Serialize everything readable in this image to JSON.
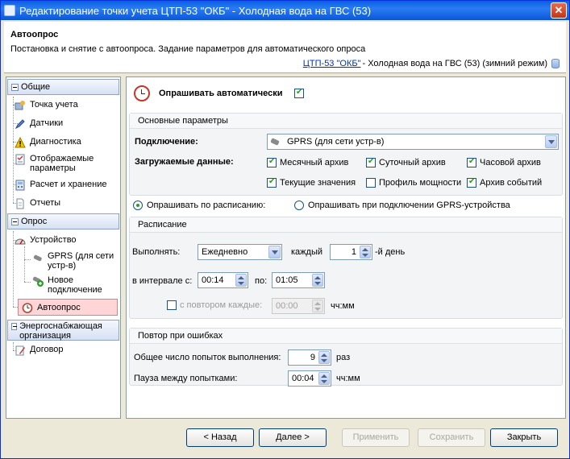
{
  "window": {
    "title": "Редактирование точки учета ЦТП-53 \"ОКБ\" - Холодная вода на ГВС (53)",
    "close": "✕"
  },
  "header": {
    "title": "Автоопрос",
    "description": "Постановка и снятие с автоопроса. Задание параметров для автоматического опроса",
    "link": "ЦТП-53 \"ОКБ\"",
    "link_suffix": " - Холодная вода на ГВС (53) (зимний режим)"
  },
  "sidebar": {
    "group_general": "Общие",
    "general_items": [
      "Точка учета",
      "Датчики",
      "Диагностика",
      "Отображаемые параметры",
      "Расчет и хранение",
      "Отчеты"
    ],
    "group_poll": "Опрос",
    "device": "Устройство",
    "device_children": [
      "GPRS (для сети устр-в)",
      "Новое подключение"
    ],
    "autopoll": "Автоопрос",
    "group_energy": "Энергоснабжающая организация",
    "contract": "Договор"
  },
  "main": {
    "auto_poll_label": "Опрашивать автоматически",
    "auto_poll_checked": true,
    "basic": {
      "title": "Основные параметры",
      "connection_label": "Подключение:",
      "connection_value": "GPRS (для сети устр-в)",
      "loaded_data_label": "Загружаемые данные:",
      "options": [
        {
          "label": "Месячный архив",
          "checked": true
        },
        {
          "label": "Суточный архив",
          "checked": true
        },
        {
          "label": "Часовой архив",
          "checked": true
        },
        {
          "label": "Текущие значения",
          "checked": true
        },
        {
          "label": "Профиль мощности",
          "checked": false
        },
        {
          "label": "Архив событий",
          "checked": true
        }
      ]
    },
    "mode": {
      "by_schedule": "Опрашивать по расписанию:",
      "on_connect": "Опрашивать при подключении GPRS-устройства"
    },
    "schedule": {
      "title": "Расписание",
      "execute_label": "Выполнять:",
      "execute_value": "Ежедневно",
      "every_label": "каждый",
      "every_value": "1",
      "every_suffix": "-й день",
      "interval_label": "в интервале с:",
      "from_value": "00:14",
      "to_label": "по:",
      "to_value": "01:05",
      "repeat_label": "с повтором каждые:",
      "repeat_value": "00:00",
      "repeat_unit": "чч:мм"
    },
    "retry": {
      "title": "Повтор при ошибках",
      "total_label": "Общее число попыток выполнения:",
      "total_value": "9",
      "total_unit": "раз",
      "pause_label": "Пауза между попытками:",
      "pause_value": "00:04",
      "pause_unit": "чч:мм"
    }
  },
  "buttons": {
    "back": "< Назад",
    "next": "Далее >",
    "apply": "Применить",
    "save": "Сохранить",
    "close": "Закрыть"
  }
}
